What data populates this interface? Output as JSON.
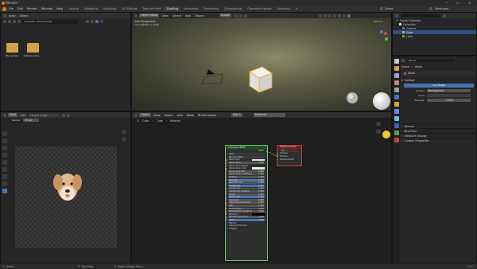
{
  "window": {
    "title": "Blender",
    "controls": [
      "—",
      "☐",
      "✕"
    ]
  },
  "menu": [
    "File",
    "Edit",
    "Render",
    "Window",
    "Help"
  ],
  "workspace_tabs": [
    {
      "label": "Layout",
      "active": false
    },
    {
      "label": "Modeling",
      "active": false
    },
    {
      "label": "Sculpting",
      "active": false
    },
    {
      "label": "UV Editing",
      "active": false
    },
    {
      "label": "Texture Paint",
      "active": false
    },
    {
      "label": "Shading",
      "active": true
    },
    {
      "label": "Animation",
      "active": false
    },
    {
      "label": "Rendering",
      "active": false
    },
    {
      "label": "Compositing",
      "active": false
    },
    {
      "label": "Geometry Nodes",
      "active": false
    },
    {
      "label": "Scripting",
      "active": false
    }
  ],
  "scene_field": "Scene",
  "view_layer_field": "ViewLayer",
  "file_browser": {
    "menu": [
      "View",
      "Select"
    ],
    "path": "C:\\Users\\...\\Documents\\",
    "items": [
      {
        "name": "My Games"
      },
      {
        "name": "Videos\\remix..."
      }
    ]
  },
  "viewport": {
    "mode": "Object Mode",
    "menu": [
      "View",
      "Select",
      "Add",
      "Object"
    ],
    "transform": "Global",
    "overlay_title": "User Perspective",
    "overlay_sub": "(1) Collection | Cube",
    "options": "Options"
  },
  "outliner": {
    "root": "Scene Collection",
    "collection": "Collection",
    "items": [
      {
        "name": "Camera",
        "selected": false
      },
      {
        "name": "Cube",
        "selected": true
      },
      {
        "name": "Light",
        "selected": false
      }
    ]
  },
  "image_editor": {
    "header_label": "Paint",
    "image_name": "Flinque ( copy",
    "subheader": [
      "Radius",
      "50 px"
    ],
    "view_label": "View"
  },
  "shader_editor": {
    "menu": [
      "Object",
      "View",
      "Select",
      "Add",
      "Node"
    ],
    "use_nodes": "Use Nodes",
    "slot": "Slot 1",
    "material": "Material",
    "breadcrumb": [
      "Cube",
      "Cube",
      "Material"
    ],
    "bsdf": {
      "title": "Principled BSDF",
      "output": "BSDF",
      "rows": [
        {
          "label": "GGX",
          "value": "",
          "type": "dropdown"
        },
        {
          "label": "Random Walk",
          "value": "",
          "type": "dropdown"
        },
        {
          "label": "Base Color",
          "value": "",
          "type": "color"
        },
        {
          "label": "Subsurface",
          "value": "0.000",
          "type": "slider"
        },
        {
          "label": "Subsurface Radius",
          "value": "",
          "type": "vector"
        },
        {
          "label": "Subsurface Color",
          "value": "",
          "type": "color"
        },
        {
          "label": "Subsurface IOR",
          "value": "1.400",
          "type": "slider"
        },
        {
          "label": "Subsurface Anisotropy",
          "value": "0.000",
          "type": "slider"
        },
        {
          "label": "Metallic",
          "value": "0.000",
          "type": "slider"
        },
        {
          "label": "Specular",
          "value": "0.500",
          "type": "slider-blue"
        },
        {
          "label": "Specular Tint",
          "value": "0.000",
          "type": "slider"
        },
        {
          "label": "Roughness",
          "value": "0.500",
          "type": "slider-blue"
        },
        {
          "label": "Anisotropic",
          "value": "0.000",
          "type": "slider"
        },
        {
          "label": "Anisotropic Rotation",
          "value": "0.000",
          "type": "slider"
        },
        {
          "label": "Sheen",
          "value": "0.000",
          "type": "slider"
        },
        {
          "label": "Sheen Tint",
          "value": "0.500",
          "type": "slider-blue"
        },
        {
          "label": "Clearcoat",
          "value": "0.000",
          "type": "slider"
        },
        {
          "label": "Clearcoat Roughness",
          "value": "0.030",
          "type": "slider"
        },
        {
          "label": "IOR",
          "value": "1.450",
          "type": "slider"
        },
        {
          "label": "Transmission",
          "value": "0.000",
          "type": "slider"
        },
        {
          "label": "Transmission Roughness",
          "value": "0.000",
          "type": "slider"
        },
        {
          "label": "Emission",
          "value": "",
          "type": "color-black"
        },
        {
          "label": "Emission Strength",
          "value": "1.000",
          "type": "slider"
        },
        {
          "label": "Alpha",
          "value": "1.000",
          "type": "slider-blue"
        },
        {
          "label": "Normal",
          "value": "",
          "type": "plain"
        },
        {
          "label": "Clearcoat Normal",
          "value": "",
          "type": "plain"
        },
        {
          "label": "Tangent",
          "value": "",
          "type": "plain"
        }
      ]
    },
    "output_node": {
      "title": "Material Output",
      "dropdown": "All",
      "rows": [
        "Surface",
        "Volume",
        "Displacement"
      ]
    }
  },
  "properties": {
    "search": "World",
    "tabs": [
      "Scene",
      "World"
    ],
    "sections": [
      {
        "label": "Surface",
        "open": true
      },
      {
        "label": "Volume",
        "open": false
      },
      {
        "label": "Mist Pass",
        "open": false
      },
      {
        "label": "Viewport Display",
        "open": false
      },
      {
        "label": "Custom Properties",
        "open": false
      }
    ],
    "use_nodes": "Use Nodes",
    "surface_label": "Surface",
    "surface_value": "Background",
    "color_label": "Color",
    "strength_label": "Strength",
    "strength_value": "1.000"
  },
  "status_bar": {
    "left": "Select",
    "middle": "Pan View",
    "right": "Node Context Menu",
    "version": "2.9.1"
  },
  "colors": {
    "accent": "#4772b3",
    "selected_orange": "#f5a623",
    "node_green_header": "#1f4f1f",
    "node_red_header": "#6e1e1e"
  }
}
